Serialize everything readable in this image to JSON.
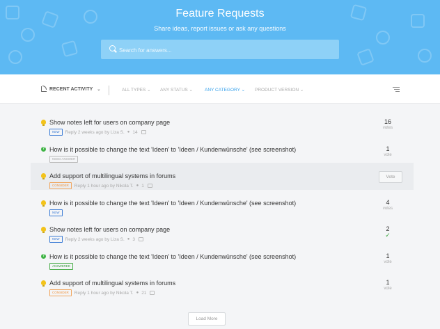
{
  "header": {
    "title": "Feature Requests",
    "subtitle": "Share ideas, report issues or ask any questions"
  },
  "search": {
    "placeholder": "Search for answers..."
  },
  "filters": {
    "recent_label": "RECENT ACTIVITY",
    "all_types": "ALL TYPES",
    "any_status": "ANY STATUS",
    "any_category": "ANY CATEGORY",
    "product_version": "PRODUCT VERSION"
  },
  "items": [
    {
      "kind": "idea",
      "title": "Show notes left for users on company page",
      "badge": "NEW",
      "badge_style": "new",
      "meta": "Reply 2 weeks ago by Liza S.",
      "comments": "14",
      "votes": "16",
      "votes_label": "votes"
    },
    {
      "kind": "question",
      "title": "How is it possible to change the text 'Ideen' to 'Ideen / Kundenwünsche' (see screenshot)",
      "badge": "NEED ANSWER",
      "badge_style": "need",
      "meta": "",
      "comments": "",
      "votes": "1",
      "votes_label": "vote"
    },
    {
      "kind": "idea",
      "title": "Add support of multilingual systems in forums",
      "badge": "CONSIDER",
      "badge_style": "consider",
      "meta": "Reply 1 hour ago by Nikola T.",
      "comments": "1",
      "vote_button": "Vote"
    },
    {
      "kind": "idea",
      "title": "How is it possible to change the text 'Ideen' to 'Ideen / Kundenwünsche' (see screenshot)",
      "badge": "NEW",
      "badge_style": "new",
      "meta": "",
      "comments": "",
      "votes": "4",
      "votes_label": "votes"
    },
    {
      "kind": "idea",
      "title": "Show notes left for users on company page",
      "badge": "NEW",
      "badge_style": "new",
      "meta": "Reply 2 weeks ago by Liza S.",
      "comments": "3",
      "votes": "2",
      "voted": "✓"
    },
    {
      "kind": "question",
      "title": "How is it possible to change the text 'Ideen' to 'Ideen / Kundenwünsche' (see screenshot)",
      "badge": "ANSWERED",
      "badge_style": "answered",
      "meta": "",
      "comments": "",
      "votes": "1",
      "votes_label": "vote"
    },
    {
      "kind": "idea",
      "title": "Add support of multilingual systems in forums",
      "badge": "CONSIDER",
      "badge_style": "consider",
      "meta": "Reply 1 hour ago by Nikola T.",
      "comments": "21",
      "votes": "1",
      "votes_label": "vote"
    }
  ],
  "load_more": "Load More",
  "colors": {
    "hero": "#5db9f3",
    "accent": "#3aa3ec",
    "idea": "#f3c31b",
    "question": "#3fb445"
  }
}
